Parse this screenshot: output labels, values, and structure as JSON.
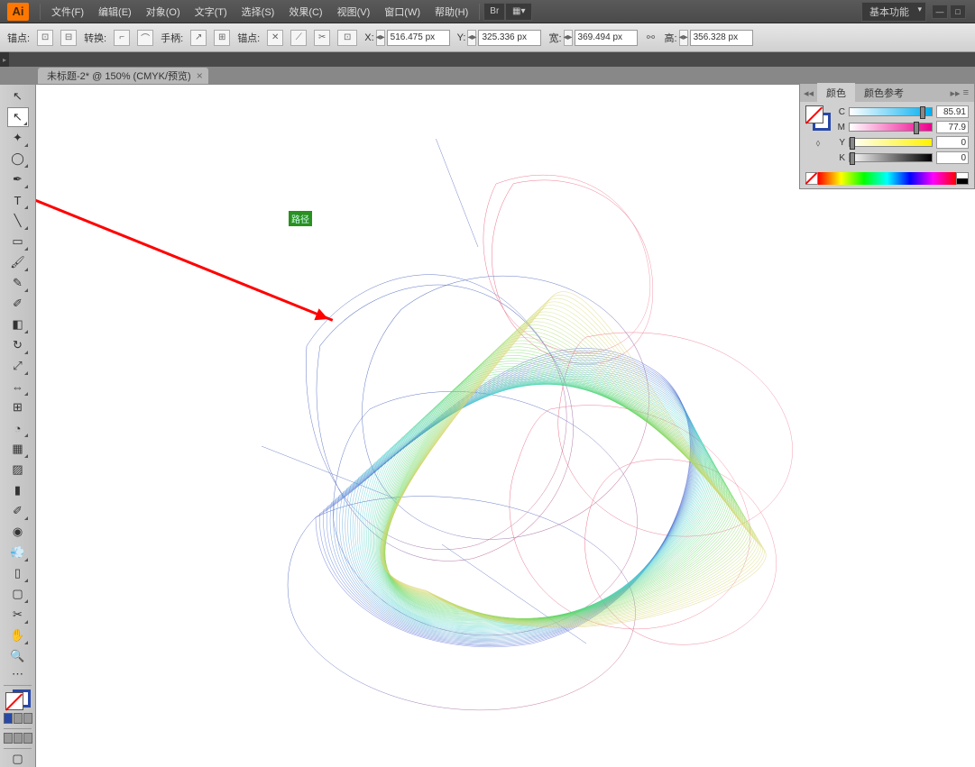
{
  "app": {
    "icon_text": "Ai"
  },
  "menu": {
    "items": [
      "文件(F)",
      "编辑(E)",
      "对象(O)",
      "文字(T)",
      "选择(S)",
      "效果(C)",
      "视图(V)",
      "窗口(W)",
      "帮助(H)"
    ]
  },
  "workspace_switcher": {
    "label": "基本功能"
  },
  "control_bar": {
    "anchor_label": "锚点:",
    "convert_label": "转换:",
    "handle_label": "手柄:",
    "anchor2_label": "锚点:",
    "x_label": "X:",
    "x_value": "516.475 px",
    "y_label": "Y:",
    "y_value": "325.336 px",
    "w_label": "宽:",
    "w_value": "369.494 px",
    "h_label": "高:",
    "h_value": "356.328 px"
  },
  "tab": {
    "title": "未标题-2* @ 150% (CMYK/预览)"
  },
  "canvas_badge": "路径",
  "color_panel": {
    "tabs": [
      "颜色",
      "颜色参考"
    ],
    "channels": [
      {
        "label": "C",
        "class": "c",
        "value": "85.91",
        "pos": 86
      },
      {
        "label": "M",
        "class": "m",
        "value": "77.9",
        "pos": 78
      },
      {
        "label": "Y",
        "class": "y",
        "value": "0",
        "pos": 0
      },
      {
        "label": "K",
        "class": "k",
        "value": "0",
        "pos": 0
      }
    ]
  },
  "tools": [
    {
      "name": "selection",
      "glyph": "↖",
      "flyout": false
    },
    {
      "name": "direct-selection",
      "glyph": "↖",
      "flyout": true,
      "selected": true
    },
    {
      "name": "magic-wand",
      "glyph": "✦",
      "flyout": true
    },
    {
      "name": "lasso",
      "glyph": "◯",
      "flyout": true
    },
    {
      "name": "pen",
      "glyph": "✒",
      "flyout": true
    },
    {
      "name": "type",
      "glyph": "T",
      "flyout": true
    },
    {
      "name": "line",
      "glyph": "╲",
      "flyout": true
    },
    {
      "name": "rectangle",
      "glyph": "▭",
      "flyout": true
    },
    {
      "name": "paintbrush",
      "glyph": "🖌",
      "flyout": true
    },
    {
      "name": "pencil",
      "glyph": "✎",
      "flyout": true
    },
    {
      "name": "blob-brush",
      "glyph": "✐",
      "flyout": false
    },
    {
      "name": "eraser",
      "glyph": "◧",
      "flyout": true
    },
    {
      "name": "rotate",
      "glyph": "↻",
      "flyout": true
    },
    {
      "name": "scale",
      "glyph": "⤢",
      "flyout": true
    },
    {
      "name": "width",
      "glyph": "⇔",
      "flyout": true
    },
    {
      "name": "free-transform",
      "glyph": "⊞",
      "flyout": false
    },
    {
      "name": "shape-builder",
      "glyph": "◔",
      "flyout": true
    },
    {
      "name": "perspective",
      "glyph": "▦",
      "flyout": true
    },
    {
      "name": "mesh",
      "glyph": "▨",
      "flyout": false
    },
    {
      "name": "gradient",
      "glyph": "▮",
      "flyout": false
    },
    {
      "name": "eyedropper",
      "glyph": "✐",
      "flyout": true
    },
    {
      "name": "blend",
      "glyph": "◉",
      "flyout": false
    },
    {
      "name": "symbol-sprayer",
      "glyph": "💨",
      "flyout": true
    },
    {
      "name": "column-graph",
      "glyph": "▯",
      "flyout": true
    },
    {
      "name": "artboard",
      "glyph": "▢",
      "flyout": true
    },
    {
      "name": "slice",
      "glyph": "✂",
      "flyout": true
    },
    {
      "name": "hand",
      "glyph": "✋",
      "flyout": true
    },
    {
      "name": "zoom",
      "glyph": "🔍",
      "flyout": false
    }
  ]
}
